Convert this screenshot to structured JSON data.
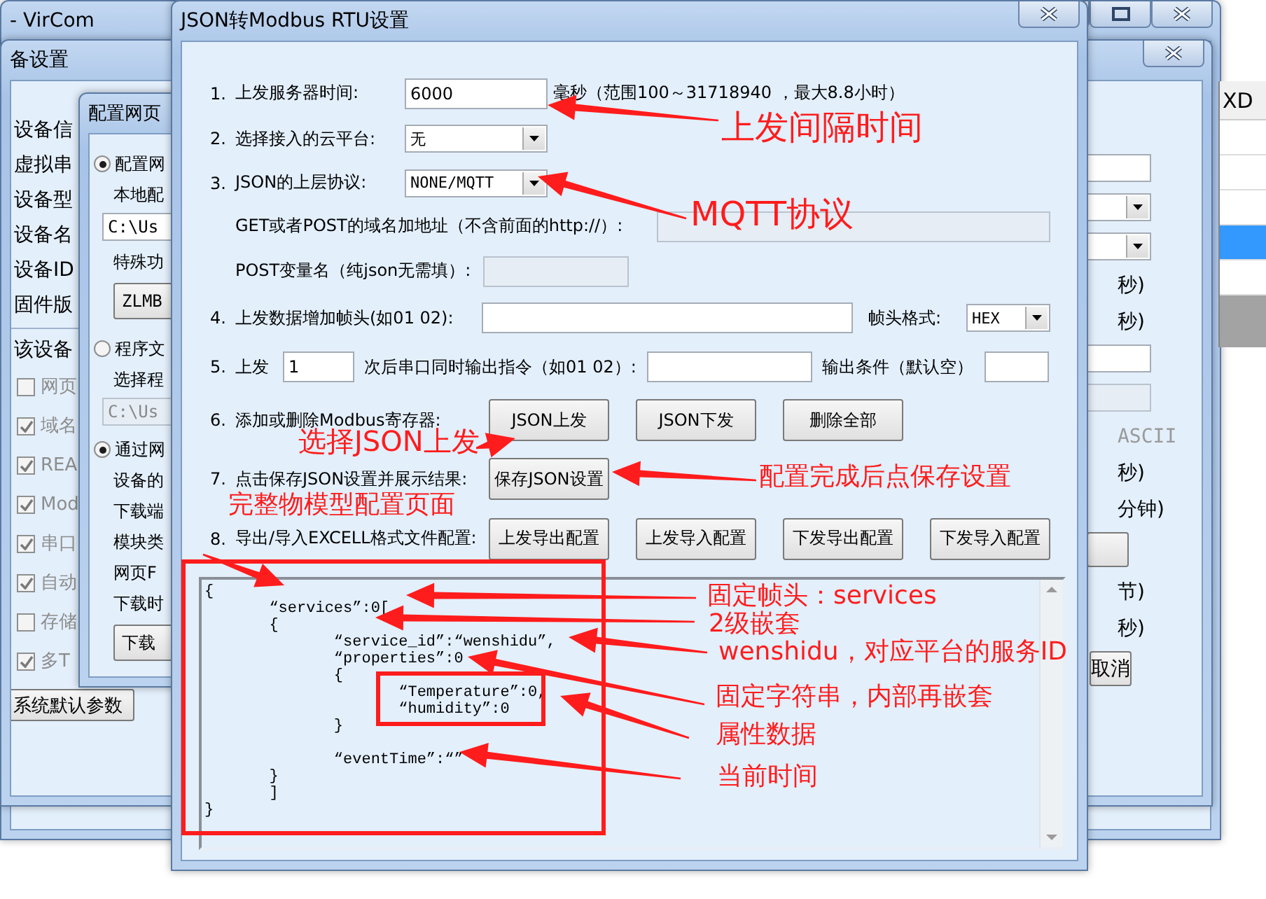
{
  "main_window": {
    "title": "- VirCom"
  },
  "side_list": {
    "header": "XD",
    "rows": [
      {
        "selected": false
      },
      {
        "selected": false
      },
      {
        "selected": false
      },
      {
        "selected": true
      },
      {
        "selected": false
      }
    ]
  },
  "device_dialog": {
    "title": "备设置",
    "labels": [
      "设备信",
      "虚拟串",
      "设备型",
      "设备名",
      "设备ID",
      "固件版"
    ],
    "section_label": "该设备",
    "options": [
      {
        "label": "网页",
        "checked": false,
        "disabled": true
      },
      {
        "label": "域名",
        "checked": true,
        "disabled": true
      },
      {
        "label": "REA",
        "checked": true,
        "disabled": true
      },
      {
        "label": "Mod",
        "checked": true,
        "disabled": true
      },
      {
        "label": "串口",
        "checked": true,
        "disabled": true
      },
      {
        "label": "自动",
        "checked": true,
        "disabled": true
      },
      {
        "label": "存储",
        "checked": false,
        "disabled": true
      },
      {
        "label": "多T",
        "checked": true,
        "disabled": true
      }
    ],
    "default_button": "系统默认参数",
    "right_items": [
      {
        "kind": "field",
        "disabled": false
      },
      {
        "kind": "select"
      },
      {
        "kind": "select"
      },
      {
        "kind": "text",
        "text": "秒)",
        "disabled": false
      },
      {
        "kind": "text",
        "text": "秒)",
        "disabled": false
      },
      {
        "kind": "field",
        "disabled": false
      },
      {
        "kind": "field",
        "disabled": true
      },
      {
        "kind": "text",
        "text": "ASCII",
        "disabled": true
      },
      {
        "kind": "text",
        "text": "秒)",
        "disabled": false
      },
      {
        "kind": "text",
        "text": "分钟)",
        "disabled": false
      },
      {
        "kind": "button"
      },
      {
        "kind": "text",
        "text": "节)",
        "disabled": false
      },
      {
        "kind": "text",
        "text": "秒)",
        "disabled": false
      }
    ],
    "cancel_button": "取消"
  },
  "config_dialog": {
    "title": "配置网页",
    "items": [
      {
        "kind": "radio",
        "label": "配置网",
        "selected": true
      },
      {
        "kind": "text",
        "label": "本地配"
      },
      {
        "kind": "field",
        "value": "C:\\Us",
        "disabled": false
      },
      {
        "kind": "text",
        "label": "特殊功"
      },
      {
        "kind": "button",
        "label": "ZLMB"
      },
      {
        "kind": "radio",
        "label": "程序文",
        "selected": false
      },
      {
        "kind": "text",
        "label": "选择程"
      },
      {
        "kind": "field",
        "value": "C:\\Us",
        "disabled": true
      },
      {
        "kind": "radio",
        "label": "通过网",
        "selected": true
      },
      {
        "kind": "text",
        "label": "设备的"
      },
      {
        "kind": "text",
        "label": "下载端"
      },
      {
        "kind": "text",
        "label": "模块类"
      },
      {
        "kind": "text",
        "label": "网页F"
      },
      {
        "kind": "text",
        "label": "下载时"
      },
      {
        "kind": "button",
        "label": "下载"
      }
    ]
  },
  "json_dialog": {
    "title": "JSON转Modbus RTU设置",
    "server_time": {
      "number": "1.",
      "label": "上发服务器时间:",
      "value": "6000",
      "hint": "毫秒（范围100～31718940 ，最大8.8小时）"
    },
    "cloud_platform": {
      "number": "2.",
      "label": "选择接入的云平台:",
      "value": "无"
    },
    "protocol": {
      "number": "3.",
      "label": "JSON的上层协议:",
      "value": "NONE/MQTT"
    },
    "url": {
      "label": "GET或者POST的域名加地址（不含前面的http://）:",
      "disabled": true
    },
    "post_var": {
      "label": "POST变量名（纯json无需填）:",
      "disabled": true
    },
    "frame_header": {
      "number": "4.",
      "label": "上发数据增加帧头(如01 02):",
      "format_label": "帧头格式:",
      "format": "HEX"
    },
    "output": {
      "number": "5.",
      "prefix": "上发",
      "count": "1",
      "label": "次后串口同时输出指令（如01 02）:",
      "condition_label": "输出条件（默认空）"
    },
    "registers": {
      "number": "6.",
      "label": "添加或删除Modbus寄存器:",
      "buttons": [
        "JSON上发",
        "JSON下发",
        "删除全部"
      ]
    },
    "save": {
      "number": "7.",
      "label": "点击保存JSON设置并展示结果:",
      "button": "保存JSON设置"
    },
    "excel": {
      "number": "8.",
      "label": "导出/导入EXCELL格式文件配置:",
      "buttons": [
        "上发导出配置",
        "上发导入配置",
        "下发导出配置",
        "下发导入配置"
      ]
    },
    "json_text": "{\n       “services”:0[\n       {\n              “service_id”:“wenshidu”,\n              “properties”:0\n              {\n                     “Temperature”:0,\n                     “humidity”:0\n              }\n\n              “eventTime”:“”\n       }\n       ]\n}"
  },
  "annotations": [
    {
      "text": "上发间隔时间"
    },
    {
      "text": "MQTT协议"
    },
    {
      "text": "选择JSON上发"
    },
    {
      "text": "配置完成后点保存设置"
    },
    {
      "text": "完整物模型配置页面"
    },
    {
      "text": "固定帧头：services"
    },
    {
      "text": "2级嵌套"
    },
    {
      "text": "wenshidu，对应平台的服务ID"
    },
    {
      "text": "固定字符串，内部再嵌套"
    },
    {
      "text": "属性数据"
    },
    {
      "text": "当前时间"
    }
  ]
}
